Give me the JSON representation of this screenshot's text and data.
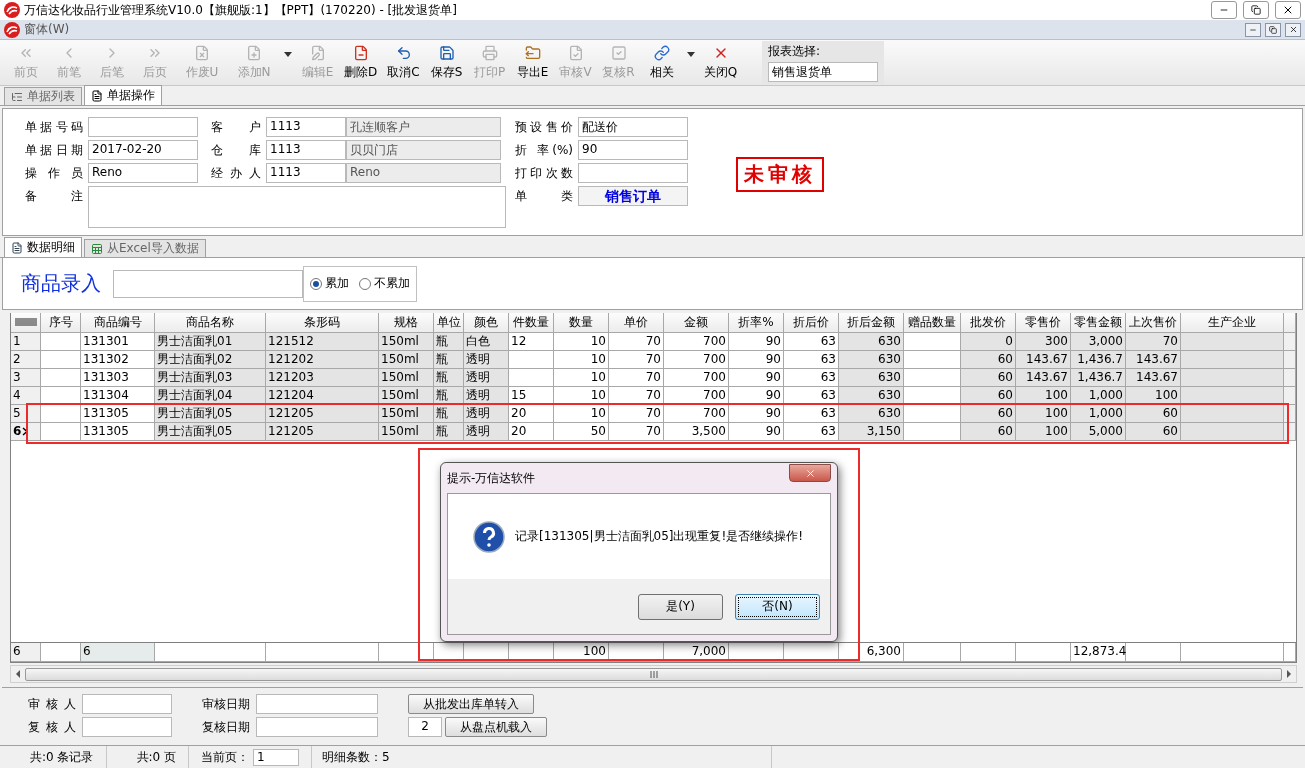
{
  "window": {
    "title": "万信达化妆品行业管理系统V10.0【旗舰版:1】【PPT】(170220) - [批发退货单]"
  },
  "mdi_menu": {
    "label": "窗体(W)"
  },
  "toolbar": [
    {
      "label": "前页",
      "kind": "first",
      "disabled": true
    },
    {
      "label": "前笔",
      "kind": "prev",
      "disabled": true
    },
    {
      "label": "后笔",
      "kind": "next",
      "disabled": true
    },
    {
      "label": "后页",
      "kind": "last",
      "disabled": true
    },
    {
      "label": "作废U",
      "kind": "void",
      "disabled": true
    },
    {
      "label": "添加N",
      "kind": "add",
      "disabled": true,
      "has_menu": true
    },
    {
      "label": "编辑E",
      "kind": "edit",
      "disabled": true
    },
    {
      "label": "删除D",
      "kind": "delete",
      "disabled": false
    },
    {
      "label": "取消C",
      "kind": "undo",
      "disabled": false
    },
    {
      "label": "保存S",
      "kind": "save",
      "disabled": false
    },
    {
      "label": "打印P",
      "kind": "print",
      "disabled": true
    },
    {
      "label": "导出E",
      "kind": "export",
      "disabled": false
    },
    {
      "label": "审核V",
      "kind": "audit",
      "disabled": true
    },
    {
      "label": "复核R",
      "kind": "review",
      "disabled": true
    },
    {
      "label": "相关",
      "kind": "link",
      "disabled": false,
      "has_menu": true
    },
    {
      "label": "关闭Q",
      "kind": "close",
      "disabled": false
    }
  ],
  "report_select": {
    "label": "报表选择:",
    "value": "销售退货单"
  },
  "tabs": [
    {
      "label": "单据列表",
      "kind": "list",
      "selected": false
    },
    {
      "label": "单据操作",
      "kind": "doc",
      "selected": true
    }
  ],
  "bill_form": {
    "main": [
      [
        {
          "kind": "field",
          "label": "单据号码"
        },
        {
          "kind": "lookup",
          "label": "客 户",
          "code": "1113",
          "name": "孔连顺客户"
        }
      ],
      [
        {
          "kind": "field",
          "label": "单据日期",
          "value": "2017-02-20"
        },
        {
          "kind": "lookup",
          "label": "仓 库",
          "code": "1113",
          "name": "贝贝门店"
        }
      ],
      [
        {
          "kind": "field",
          "label": "操 作 员",
          "value": "Reno"
        },
        {
          "kind": "lookup",
          "label": "经 办 人",
          "code": "1113",
          "name": "Reno"
        }
      ],
      [
        {
          "kind": "memo",
          "label": "备 注"
        }
      ]
    ],
    "side": [
      {
        "kind": "field",
        "label": "预设售价",
        "value": "配送价"
      },
      {
        "kind": "field",
        "label": "折 率(%)",
        "value": "90"
      },
      {
        "kind": "field",
        "label": "打印次数"
      },
      {
        "kind": "emphasis",
        "label": "单 类",
        "value": "销售订单"
      }
    ],
    "stamp": "未审核"
  },
  "detail_tabs": [
    {
      "label": "数据明细",
      "kind": "doc",
      "selected": true
    },
    {
      "label": "从Excel导入数据",
      "kind": "sheet",
      "selected": false
    }
  ],
  "entry": {
    "label": "商品录入",
    "options": [
      {
        "label": "累加",
        "selected": true
      },
      {
        "label": "不累加",
        "selected": false
      }
    ]
  },
  "grid": {
    "columns": [
      {
        "label": "序号",
        "shaded": false
      },
      {
        "label": "商品编号",
        "numeric": false,
        "shaded": false,
        "total": "6"
      },
      {
        "label": "商品名称",
        "numeric": false,
        "shaded": true
      },
      {
        "label": "条形码",
        "numeric": false,
        "shaded": true
      },
      {
        "label": "规格",
        "numeric": false,
        "shaded": true
      },
      {
        "label": "单位",
        "numeric": false,
        "shaded": true
      },
      {
        "label": "颜色",
        "numeric": false,
        "shaded": true
      },
      {
        "label": "件数量",
        "numeric": false,
        "shaded": false
      },
      {
        "label": "数量",
        "numeric": true,
        "shaded": false,
        "total": "100"
      },
      {
        "label": "单价",
        "numeric": true,
        "shaded": false
      },
      {
        "label": "金额",
        "numeric": true,
        "shaded": false,
        "total": "7,000"
      },
      {
        "label": "折率%",
        "numeric": true,
        "shaded": false
      },
      {
        "label": "折后价",
        "numeric": true,
        "shaded": false
      },
      {
        "label": "折后金额",
        "numeric": true,
        "shaded": true,
        "total": "6,300"
      },
      {
        "label": "赠品数量",
        "shaded": false
      },
      {
        "label": "批发价",
        "numeric": true,
        "shaded": true
      },
      {
        "label": "零售价",
        "numeric": true,
        "shaded": true
      },
      {
        "label": "零售金额",
        "numeric": true,
        "shaded": true,
        "total": "12,873.4"
      },
      {
        "label": "上次售价",
        "numeric": true,
        "shaded": true
      },
      {
        "label": "生产企业",
        "shaded": true
      }
    ],
    "rows": [
      {
        "number": "1",
        "current": false,
        "highlighted": false,
        "cells": [
          null,
          "131301",
          "男士洁面乳01",
          "121512",
          "150ml",
          "瓶",
          "白色",
          "12",
          "10",
          "70",
          "700",
          "90",
          "63",
          "630",
          null,
          "0",
          "300",
          "3,000",
          "70",
          null
        ]
      },
      {
        "number": "2",
        "current": false,
        "highlighted": false,
        "cells": [
          null,
          "131302",
          "男士洁面乳02",
          "121202",
          "150ml",
          "瓶",
          "透明",
          null,
          "10",
          "70",
          "700",
          "90",
          "63",
          "630",
          null,
          "60",
          "143.67",
          "1,436.7",
          "143.67",
          null
        ]
      },
      {
        "number": "3",
        "current": false,
        "highlighted": false,
        "cells": [
          null,
          "131303",
          "男士洁面乳03",
          "121203",
          "150ml",
          "瓶",
          "透明",
          null,
          "10",
          "70",
          "700",
          "90",
          "63",
          "630",
          null,
          "60",
          "143.67",
          "1,436.7",
          "143.67",
          null
        ]
      },
      {
        "number": "4",
        "current": false,
        "highlighted": false,
        "cells": [
          null,
          "131304",
          "男士洁面乳04",
          "121204",
          "150ml",
          "瓶",
          "透明",
          "15",
          "10",
          "70",
          "700",
          "90",
          "63",
          "630",
          null,
          "60",
          "100",
          "1,000",
          "100",
          null
        ]
      },
      {
        "number": "5",
        "current": false,
        "highlighted": true,
        "cells": [
          null,
          "131305",
          "男士洁面乳05",
          "121205",
          "150ml",
          "瓶",
          "透明",
          "20",
          "10",
          "70",
          "700",
          "90",
          "63",
          "630",
          null,
          "60",
          "100",
          "1,000",
          "60",
          null
        ]
      },
      {
        "number": "6",
        "current": true,
        "highlighted": true,
        "cells": [
          null,
          "131305",
          "男士洁面乳05",
          "121205",
          "150ml",
          "瓶",
          "透明",
          "20",
          "50",
          "70",
          "3,500",
          "90",
          "63",
          "3,150",
          null,
          "60",
          "100",
          "5,000",
          "60",
          null
        ]
      }
    ],
    "footer_count": "6"
  },
  "audit_form": {
    "rows": [
      [
        {
          "kind": "field",
          "label": "审 核 人"
        },
        {
          "kind": "field",
          "label": "审核日期"
        },
        {
          "kind": "button",
          "label": "从批发出库单转入"
        }
      ],
      [
        {
          "kind": "field",
          "label": "复 核 人"
        },
        {
          "kind": "field",
          "label": "复核日期"
        },
        {
          "kind": "counted_button",
          "value": "2",
          "label": "从盘点机载入"
        }
      ]
    ]
  },
  "status_bar": {
    "records": "共:0 条记录",
    "pages": "共:0 页",
    "page_label": "当前页：",
    "page": "1",
    "detail_count": "明细条数：5"
  },
  "dialog": {
    "title": "提示-万信达软件",
    "message": "记录[131305|男士洁面乳05]出现重复!是否继续操作!",
    "highlighted": true,
    "buttons": [
      {
        "label": "是(Y)",
        "focused": false
      },
      {
        "label": "否(N)",
        "focused": true
      }
    ]
  }
}
